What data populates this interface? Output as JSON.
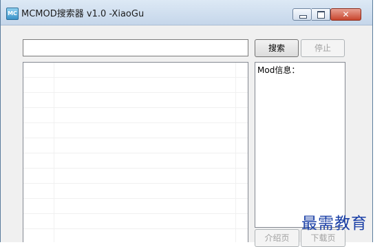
{
  "window": {
    "icon_text": "MC",
    "title": "MCMOD搜索器 v1.0 -XiaoGu"
  },
  "toolbar": {
    "search_value": "",
    "search_label": "搜索",
    "stop_label": "停止"
  },
  "info_panel": {
    "text": "Mod信息："
  },
  "bottom_buttons": {
    "intro_label": "介绍页",
    "download_label": "下载页"
  },
  "watermark": {
    "text": "最需教育"
  }
}
